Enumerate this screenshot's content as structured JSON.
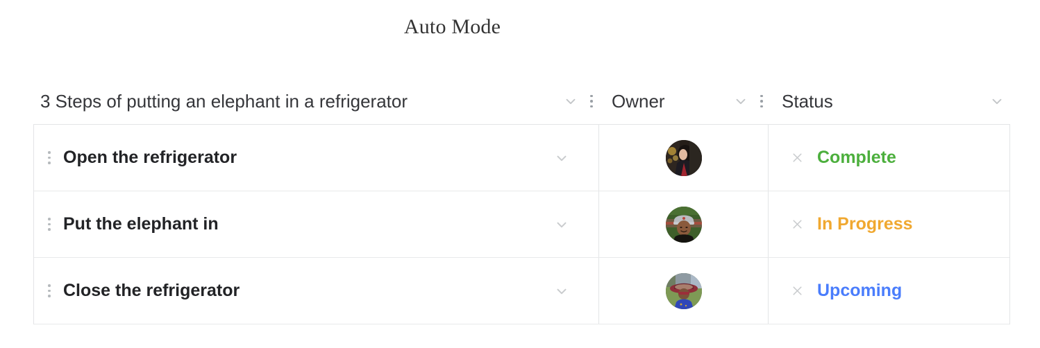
{
  "page": {
    "title": "Auto Mode"
  },
  "colors": {
    "complete": "#4caf3d",
    "in_progress": "#f0a830",
    "upcoming": "#4a7dfc",
    "header_text": "#35363a",
    "row_text": "#222326",
    "border": "#e3e4e6",
    "icon_muted": "#c9ccce"
  },
  "table": {
    "columns": [
      {
        "key": "task",
        "label": "3 Steps of putting an elephant in a refrigerator",
        "chevron": "chevron-down-icon",
        "kebab": "more-options-icon"
      },
      {
        "key": "owner",
        "label": "Owner",
        "chevron": "chevron-down-icon",
        "kebab": "more-options-icon"
      },
      {
        "key": "status",
        "label": "Status",
        "chevron": "chevron-down-icon",
        "kebab": ""
      }
    ],
    "rows": [
      {
        "handle": "drag-handle-icon",
        "task": "Open the refrigerator",
        "chevron": "chevron-down-icon",
        "owner_avatar": "avatar-dark-haired-person",
        "remove": "remove-icon",
        "status": "Complete",
        "status_color": "#4caf3d"
      },
      {
        "handle": "drag-handle-icon",
        "task": "Put the elephant in",
        "chevron": "chevron-down-icon",
        "owner_avatar": "avatar-person-with-cap",
        "remove": "remove-icon",
        "status": "In Progress",
        "status_color": "#f0a830"
      },
      {
        "handle": "drag-handle-icon",
        "task": "Close the refrigerator",
        "chevron": "chevron-down-icon",
        "owner_avatar": "avatar-person-with-sunhat",
        "remove": "remove-icon",
        "status": "Upcoming",
        "status_color": "#4a7dfc"
      }
    ]
  }
}
